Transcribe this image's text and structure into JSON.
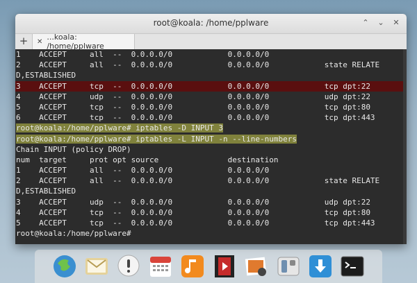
{
  "window": {
    "title": "root@koala: /home/pplware",
    "controls": [
      "⌃",
      "⌄",
      "✕"
    ]
  },
  "tabbar": {
    "new_tab_label": "+",
    "tab_close": "✕",
    "tab_label": "...koala: /home/pplware"
  },
  "terminal": {
    "lines": [
      "1    ACCEPT     all  --  0.0.0.0/0            0.0.0.0/0",
      "2    ACCEPT     all  --  0.0.0.0/0            0.0.0.0/0            state RELATE",
      "D,ESTABLISHED",
      "3    ACCEPT     tcp  --  0.0.0.0/0            0.0.0.0/0            tcp dpt:22",
      "4    ACCEPT     udp  --  0.0.0.0/0            0.0.0.0/0            udp dpt:22",
      "5    ACCEPT     tcp  --  0.0.0.0/0            0.0.0.0/0            tcp dpt:80",
      "6    ACCEPT     tcp  --  0.0.0.0/0            0.0.0.0/0            tcp dpt:443",
      "root@koala:/home/pplware# iptables -D INPUT 3",
      "root@koala:/home/pplware# iptables -L INPUT -n --line-numbers",
      "Chain INPUT (policy DROP)",
      "num  target     prot opt source               destination",
      "1    ACCEPT     all  --  0.0.0.0/0            0.0.0.0/0",
      "2    ACCEPT     all  --  0.0.0.0/0            0.0.0.0/0            state RELATE",
      "D,ESTABLISHED",
      "3    ACCEPT     udp  --  0.0.0.0/0            0.0.0.0/0            udp dpt:22",
      "4    ACCEPT     tcp  --  0.0.0.0/0            0.0.0.0/0            tcp dpt:80",
      "5    ACCEPT     tcp  --  0.0.0.0/0            0.0.0.0/0            tcp dpt:443",
      "root@koala:/home/pplware#"
    ]
  },
  "dock": {
    "icons": [
      "browser-icon",
      "mail-icon",
      "chat-icon",
      "calendar-icon",
      "music-icon",
      "video-icon",
      "photos-icon",
      "settings-icon",
      "download-icon",
      "terminal-icon"
    ]
  },
  "colors": {
    "terminal_bg": "#2c2c2c",
    "highlight_red": "#5a0f0f",
    "highlight_yellow": "#e6eb50"
  }
}
